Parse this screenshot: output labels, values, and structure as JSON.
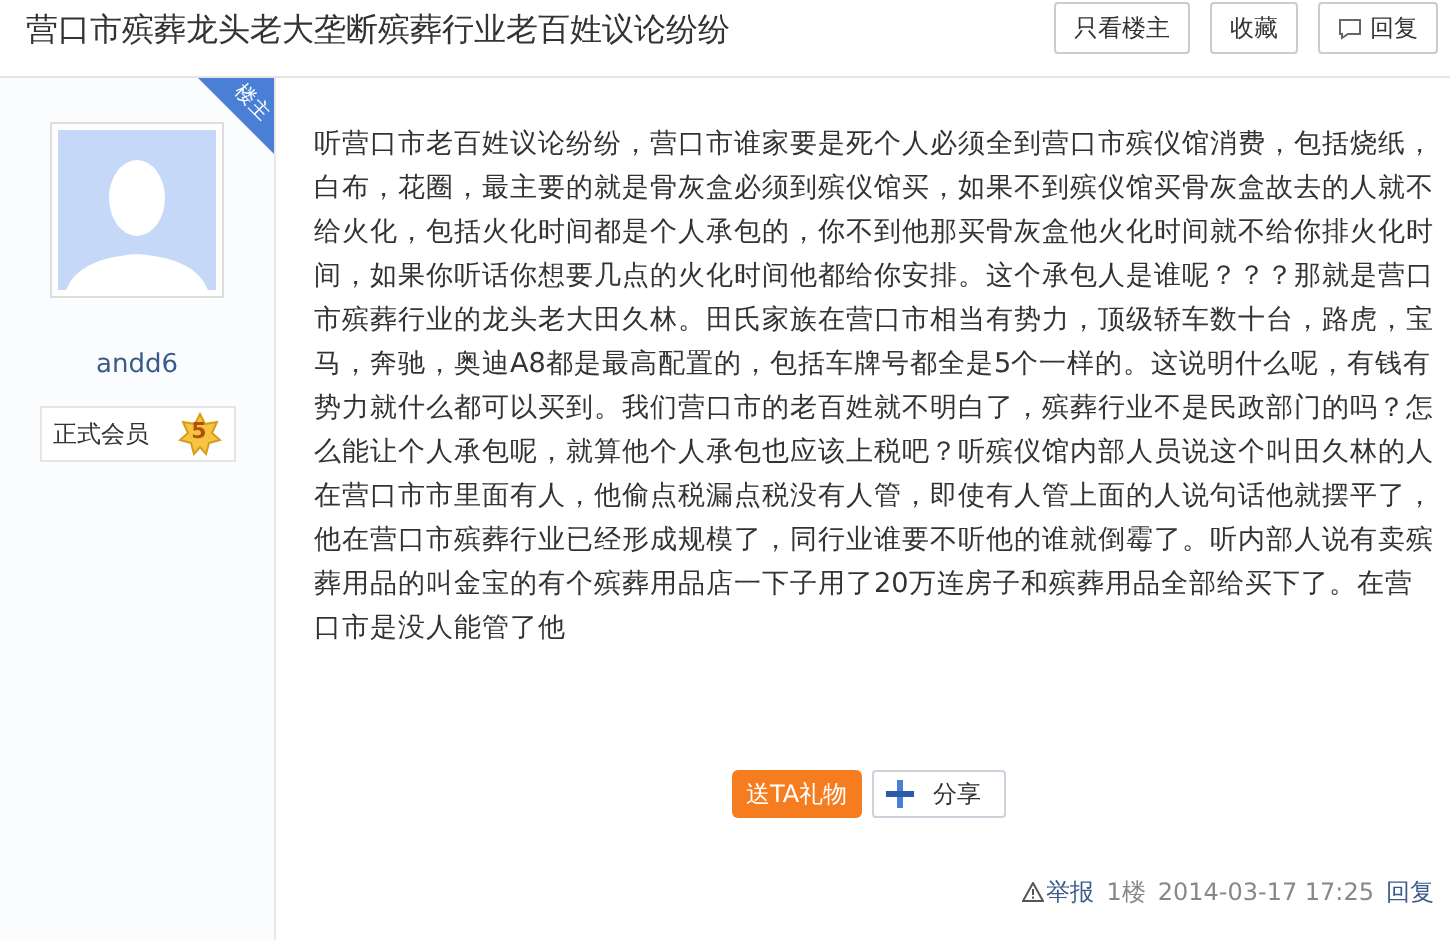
{
  "title": "营口市殡葬龙头老大垄断殡葬行业老百姓议论纷纷",
  "header_buttons": [
    {
      "label": "只看楼主",
      "kind": "plain"
    },
    {
      "label": "收藏",
      "kind": "plain"
    },
    {
      "label": "回复",
      "kind": "reply"
    }
  ],
  "author": {
    "badge": "楼主",
    "name": "andd6",
    "rank": "正式会员",
    "level": "5"
  },
  "post": {
    "body": "听营口市老百姓议论纷纷，营口市谁家要是死个人必须全到营口市殡仪馆消费，包括烧纸，白布，花圈，最主要的就是骨灰盒必须到殡仪馆买，如果不到殡仪馆买骨灰盒故去的人就不给火化，包括火化时间都是个人承包的，你不到他那买骨灰盒他火化时间就不给你排火化时间，如果你听话你想要几点的火化时间他都给你安排。这个承包人是谁呢？？？那就是营口市殡葬行业的龙头老大田久林。田氏家族在营口市相当有势力，顶级轿车数十台，路虎，宝马，奔驰，奥迪A8都是最高配置的，包括车牌号都全是5个一样的。这说明什么呢，有钱有势力就什么都可以买到。我们营口市的老百姓就不明白了，殡葬行业不是民政部门的吗？怎么能让个人承包呢，就算他个人承包也应该上税吧？听殡仪馆内部人员说这个叫田久林的人在营口市市里面有人，他偷点税漏点税没有人管，即使有人管上面的人说句话他就摆平了，他在营口市殡葬行业已经形成规模了，同行业谁要不听他的谁就倒霉了。听内部人说有卖殡葬用品的叫金宝的有个殡葬用品店一下子用了20万连房子和殡葬用品全部给买下了。在营口市是没人能管了他",
    "gift_button": "送TA礼物",
    "share_button": "分享"
  },
  "footer": {
    "report": "举报",
    "floor": "1楼",
    "time": "2014-03-17 17:25",
    "reply": "回复"
  }
}
